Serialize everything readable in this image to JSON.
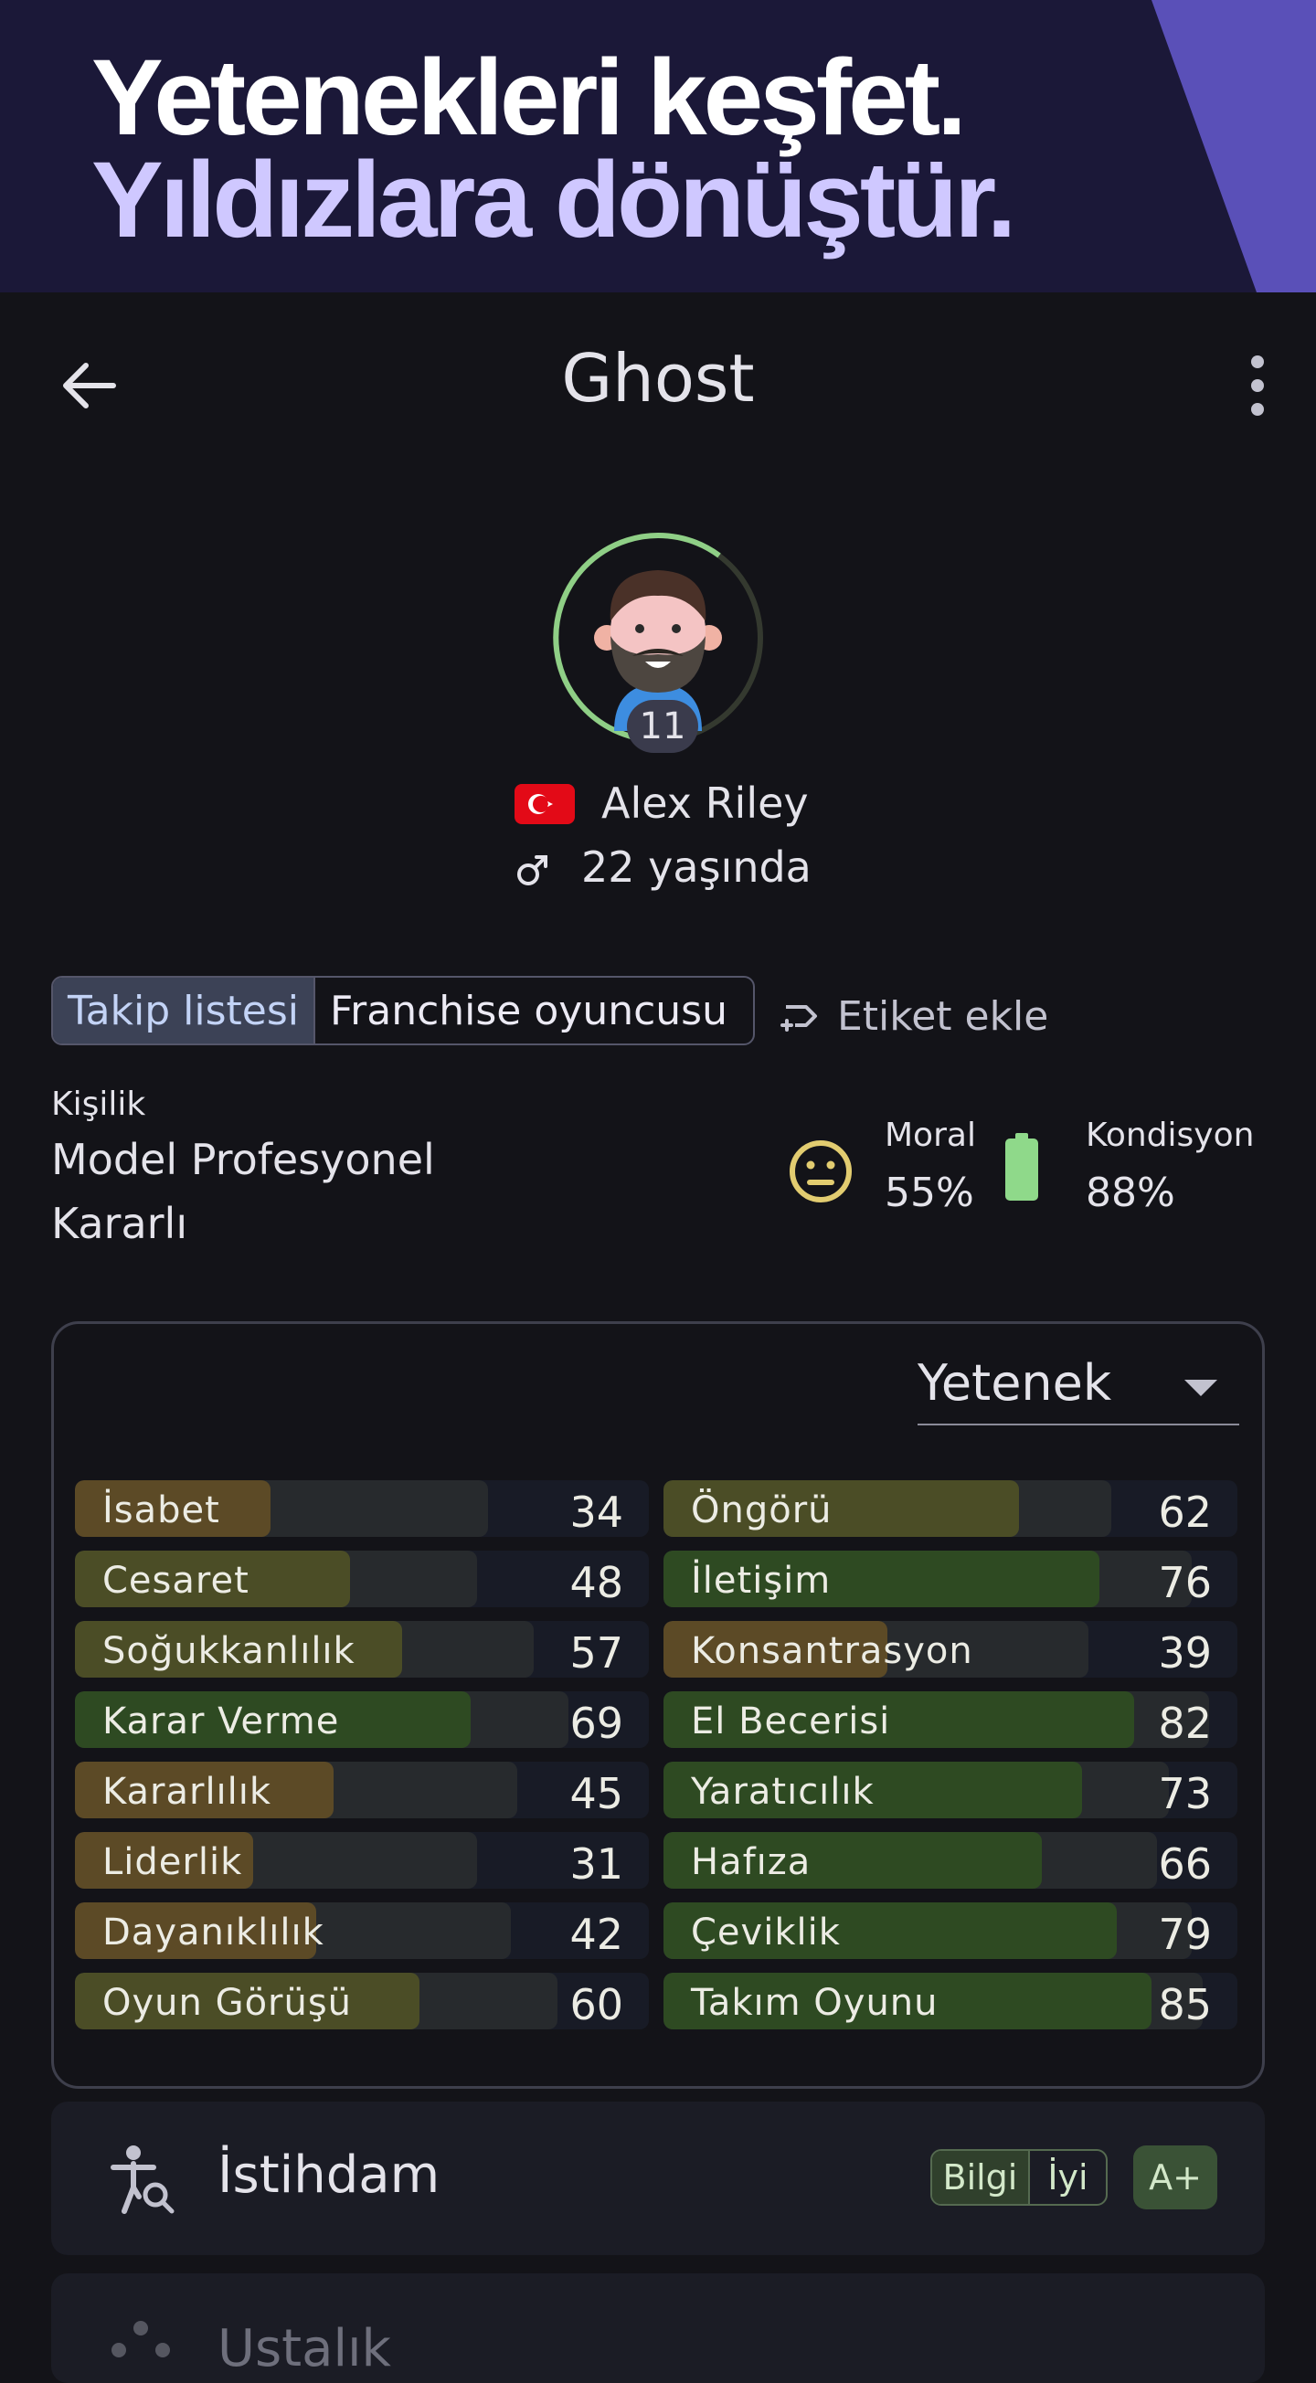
{
  "banner": {
    "line1": "Yetenekleri keşfet.",
    "line2": "Yıldızlara dönüştür."
  },
  "appbar": {
    "title": "Ghost",
    "back_icon": "arrow-back-icon",
    "menu_icon": "more-vert-icon"
  },
  "player": {
    "number": "11",
    "name": "Alex Riley",
    "age": "22 yaşında",
    "flag": "turkey-flag",
    "gender_icon": "male-icon"
  },
  "tags": {
    "items": [
      "Takip listesi",
      "Franchise oyuncusu"
    ],
    "add_label": "Etiket ekle"
  },
  "personality": {
    "label": "Kişilik",
    "values": [
      "Model Profesyonel",
      "Kararlı"
    ]
  },
  "status": {
    "morale_label": "Moral",
    "morale_value": "55%",
    "condition_label": "Kondisyon",
    "condition_value": "88%"
  },
  "skills": {
    "dropdown_label": "Yetenek",
    "left": [
      {
        "name": "İsabet",
        "value": 34,
        "potential": 72
      },
      {
        "name": "Cesaret",
        "value": 48,
        "potential": 70
      },
      {
        "name": "Soğukkanlılık",
        "value": 57,
        "potential": 80
      },
      {
        "name": "Karar Verme",
        "value": 69,
        "potential": 86
      },
      {
        "name": "Kararlılık",
        "value": 45,
        "potential": 77
      },
      {
        "name": "Liderlik",
        "value": 31,
        "potential": 70
      },
      {
        "name": "Dayanıklılık",
        "value": 42,
        "potential": 76
      },
      {
        "name": "Oyun Görüşü",
        "value": 60,
        "potential": 84
      }
    ],
    "right": [
      {
        "name": "Öngörü",
        "value": 62,
        "potential": 78
      },
      {
        "name": "İletişim",
        "value": 76,
        "potential": 92
      },
      {
        "name": "Konsantrasyon",
        "value": 39,
        "potential": 74
      },
      {
        "name": "El Becerisi",
        "value": 82,
        "potential": 95
      },
      {
        "name": "Yaratıcılık",
        "value": 73,
        "potential": 88
      },
      {
        "name": "Hafıza",
        "value": 66,
        "potential": 86
      },
      {
        "name": "Çeviklik",
        "value": 79,
        "potential": 92
      },
      {
        "name": "Takım Oyunu",
        "value": 85,
        "potential": 94
      }
    ]
  },
  "employment": {
    "title": "İstihdam",
    "badge_info": "Bilgi",
    "badge_quality": "İyi",
    "grade": "A+"
  },
  "next_section": {
    "title": "Ustalık"
  },
  "colors": {
    "background": "#131318",
    "banner": "#1b1838",
    "banner_accent": "#cfc8ff",
    "low_skill": "#5c4a26",
    "mid_skill": "#4b4d26",
    "high_skill": "#2e4a22",
    "ring": "#8fcf86"
  }
}
